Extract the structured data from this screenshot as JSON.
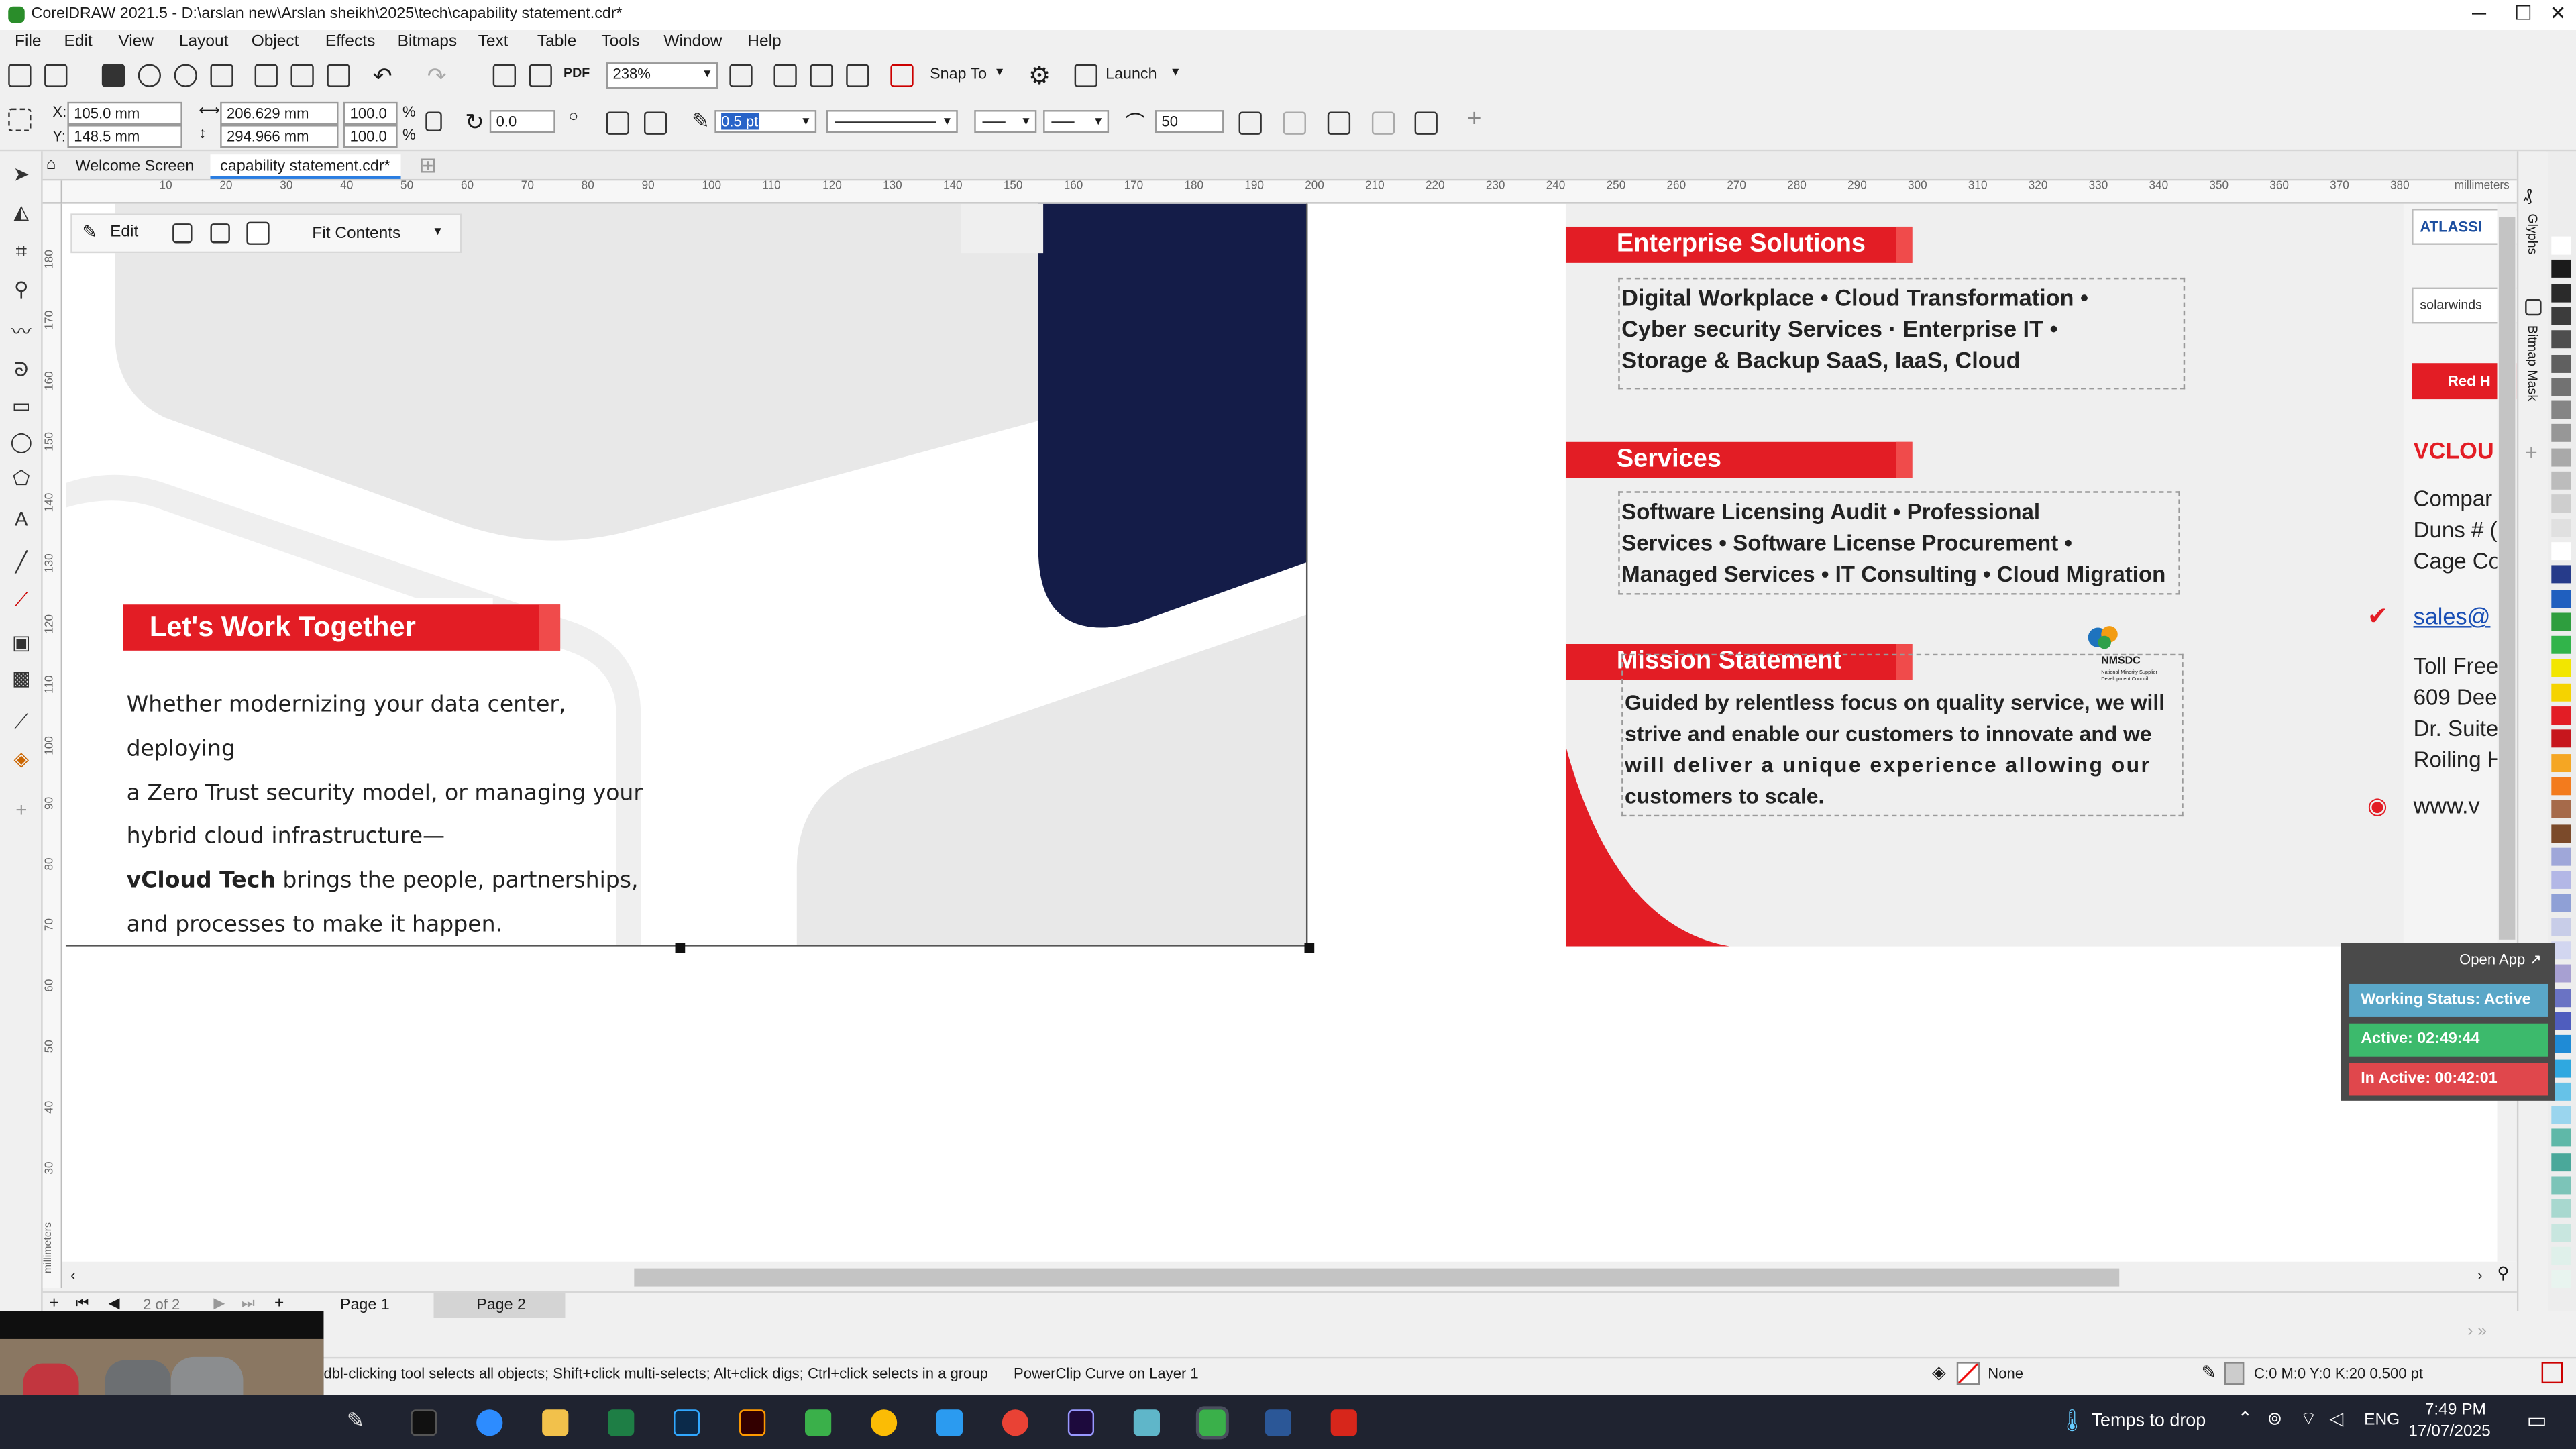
{
  "window": {
    "title": "CorelDRAW 2021.5 - D:\\arslan new\\Arslan sheikh\\2025\\tech\\capability statement.cdr*",
    "minimize": "─",
    "maximize": "☐",
    "close": "✕"
  },
  "menu": [
    "File",
    "Edit",
    "View",
    "Layout",
    "Object",
    "Effects",
    "Bitmaps",
    "Text",
    "Table",
    "Tools",
    "Window",
    "Help"
  ],
  "toolbar": {
    "zoom": "238%",
    "snap_to": "Snap To",
    "launch": "Launch"
  },
  "property_bar": {
    "x": "105.0 mm",
    "y": "148.5 mm",
    "width": "206.629 mm",
    "height": "294.966 mm",
    "scale_w": "100.0",
    "scale_h": "100.0",
    "pct": "%",
    "angle": "0.0",
    "outline_width": "0.5 pt",
    "smooth": "50",
    "lbl_x": "X:",
    "lbl_y": "Y:"
  },
  "tabs": {
    "welcome": "Welcome Screen",
    "document": "capability statement.cdr*"
  },
  "ruler": {
    "unit": "millimeters",
    "h_ticks": [
      "10",
      "20",
      "30",
      "40",
      "50",
      "60",
      "70",
      "80",
      "90",
      "100",
      "110",
      "120",
      "130",
      "140",
      "150",
      "160",
      "170",
      "180",
      "190",
      "200",
      "210",
      "220",
      "230",
      "240",
      "250",
      "260",
      "270",
      "280",
      "290",
      "300",
      "310",
      "320",
      "330",
      "340",
      "350",
      "360",
      "370",
      "380"
    ],
    "v_ticks": [
      "180",
      "170",
      "160",
      "150",
      "140",
      "130",
      "120",
      "110",
      "100",
      "90",
      "80",
      "70",
      "60",
      "50",
      "40",
      "30"
    ],
    "v_unit": "millimeters"
  },
  "powerclip_toolbar": {
    "edit": "Edit",
    "fit": "Fit Contents"
  },
  "page_left": {
    "heading": "Let's Work Together",
    "lines": [
      "Whether modernizing your data center, deploying",
      "a Zero Trust security model, or managing your",
      "hybrid cloud infrastructure—"
    ],
    "bold_lead": "vCloud Tech",
    "line4_rest": " brings the people, partnerships,",
    "line5": "and processes to make it happen."
  },
  "page_right": {
    "enterprise": {
      "title": "Enterprise Solutions",
      "lines": [
        "Digital Workplace • Cloud Transformation •",
        "Cyber security Services · Enterprise IT •",
        "Storage & Backup SaaS, IaaS, Cloud"
      ]
    },
    "services": {
      "title": "Services",
      "lines": [
        "Software Licensing Audit • Professional",
        "Services • Software License Procurement •",
        "Managed Services • IT Consulting • Cloud  Migration"
      ]
    },
    "mission": {
      "title": "Mission Statement",
      "lines": [
        "Guided by relentless focus on quality service, we will",
        "strive and enable our customers to innovate and we",
        "will deliver a unique experience allowing our",
        "customers to scale."
      ]
    },
    "nmsdc": {
      "name": "NMSDC",
      "sub": "National Minority Supplier Development Council"
    },
    "partners": [
      "ATLASSI",
      "solarwinds",
      "Red H"
    ],
    "contact": {
      "brand": "VCLOU",
      "lines": [
        "Compar",
        "Duns # (",
        "Cage Co"
      ],
      "email": "sales@",
      "address": [
        "Toll Free",
        "609 Dee",
        "Dr. Suite",
        "Roiling H"
      ],
      "web": "www.v"
    }
  },
  "docker": {
    "glyphs": "Glyphs",
    "bitmap_mask": "Bitmap Mask"
  },
  "pages": {
    "counter": "2 of 2",
    "page1": "Page 1",
    "page2": "Page 2"
  },
  "status": {
    "hint": "dbl-clicking tool selects all objects; Shift+click multi-selects; Alt+click digs; Ctrl+click selects in a group",
    "object": "PowerClip Curve on Layer 1",
    "fill": "None",
    "outline": "C:0 M:0 Y:0 K:20  0.500 pt"
  },
  "widget": {
    "open_app": "Open App ↗",
    "working": "Working Status: Active",
    "active": "Active: 02:49:44",
    "inactive": "In Active: 00:42:01"
  },
  "taskbar": {
    "weather": "Temps to drop",
    "lang": "ENG",
    "time": "7:49 PM",
    "date": "17/07/2025"
  },
  "colors": {
    "accent_red": "#e31d25",
    "navy": "#141c48",
    "canvas": "#ffffff",
    "app_bg": "#f0f0f0"
  }
}
